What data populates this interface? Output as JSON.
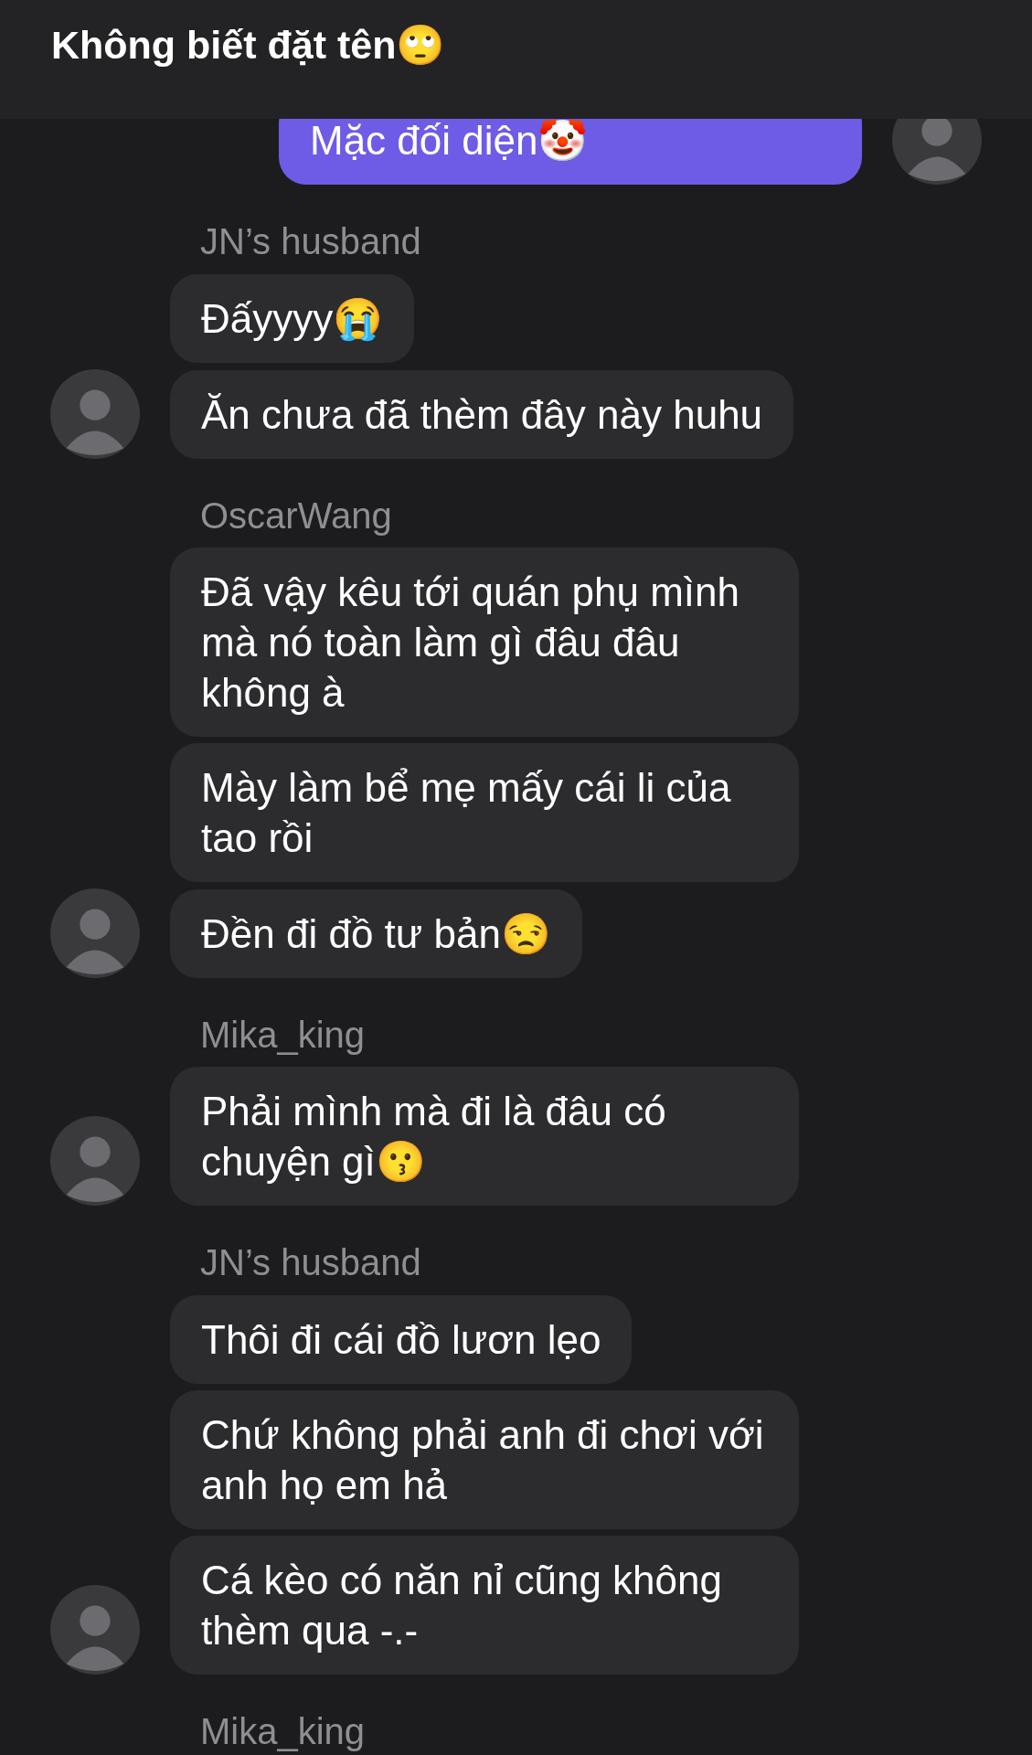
{
  "header": {
    "title": "Không biết đặt tên🙄"
  },
  "groups": [
    {
      "kind": "outgoing",
      "messages": [
        "Mặc đối diện🤡"
      ]
    },
    {
      "kind": "incoming",
      "sender": "JN’s husband",
      "messages": [
        "Đấyyyy😭",
        "Ăn chưa đã thèm đây này huhu"
      ]
    },
    {
      "kind": "incoming",
      "sender": "OscarWang",
      "messages": [
        "Đã vậy kêu tới quán phụ mình mà nó toàn làm gì đâu đâu không à",
        "Mày làm bể mẹ mấy cái li của tao rồi",
        "Đền đi đồ tư bản😒"
      ]
    },
    {
      "kind": "incoming",
      "sender": "Mika_king",
      "messages": [
        "Phải mình mà đi là đâu có chuyện gì😗"
      ]
    },
    {
      "kind": "incoming",
      "sender": "JN’s husband",
      "messages": [
        "Thôi đi cái đồ lươn lẹo",
        "Chứ không phải anh đi chơi với anh họ em hả",
        "Cá kèo có năn nỉ cũng không thèm qua -.-"
      ]
    },
    {
      "kind": "incoming",
      "sender": "Mika_king"
    }
  ]
}
